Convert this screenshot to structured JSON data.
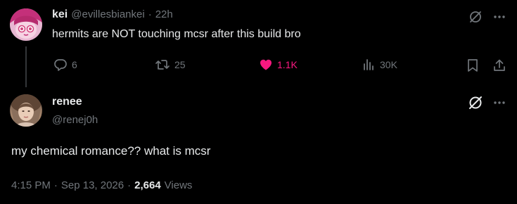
{
  "parent_tweet": {
    "display_name": "kei",
    "handle": "@evillesbiankei",
    "separator": "·",
    "age": "22h",
    "text": "hermits are NOT touching mcsr after this build bro",
    "actions": {
      "replies": "6",
      "reposts": "25",
      "likes": "1.1K",
      "views": "30K"
    }
  },
  "main_tweet": {
    "display_name": "renee",
    "handle": "@renej0h",
    "text": "my chemical romance?? what is mcsr",
    "time": "4:15 PM",
    "date": "Sep 13, 2026",
    "view_count": "2,664",
    "views_label": "Views",
    "meta_separator": "·"
  },
  "icons": {
    "grok": "grok-icon",
    "more": "more-dots-icon",
    "reply": "reply-icon",
    "repost": "repost-icon",
    "like": "heart-icon",
    "views": "views-chart-icon",
    "bookmark": "bookmark-icon",
    "share": "share-icon"
  },
  "colors": {
    "background": "#000000",
    "text": "#e7e9ea",
    "muted": "#71767b",
    "like": "#f91880",
    "divider": "#333639"
  }
}
